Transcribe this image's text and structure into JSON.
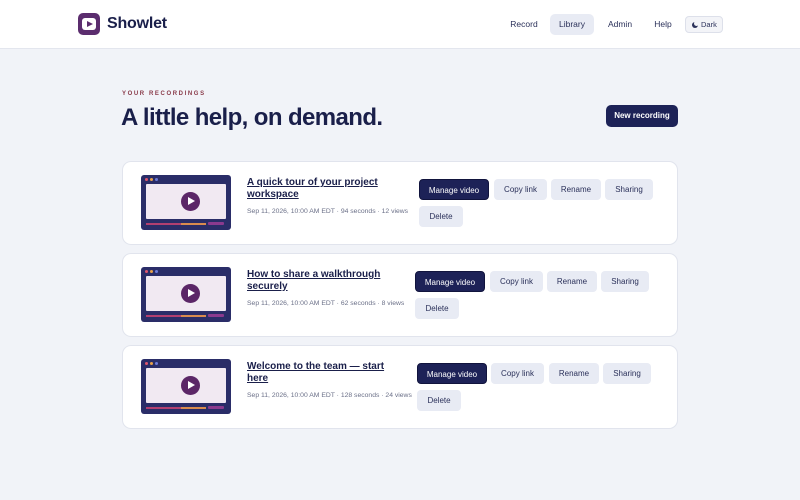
{
  "app": {
    "name": "Showlet"
  },
  "nav": {
    "items": [
      {
        "label": "Record",
        "active": false
      },
      {
        "label": "Library",
        "active": true
      },
      {
        "label": "Admin",
        "active": false
      },
      {
        "label": "Help",
        "active": false
      }
    ],
    "theme_toggle": {
      "label": "Dark",
      "icon": "moon-icon"
    }
  },
  "header": {
    "eyebrow": "YOUR RECORDINGS",
    "title": "A little help, on demand.",
    "new_button": "New recording"
  },
  "recordings": [
    {
      "title": "A quick tour of your project workspace",
      "meta": "Sep 11, 2026, 10:00 AM EDT · 94 seconds · 12 views",
      "actions": {
        "manage": "Manage video",
        "copy": "Copy link",
        "rename": "Rename",
        "sharing": "Sharing",
        "delete": "Delete"
      }
    },
    {
      "title": "How to share a walkthrough securely",
      "meta": "Sep 11, 2026, 10:00 AM EDT · 62 seconds · 8 views",
      "actions": {
        "manage": "Manage video",
        "copy": "Copy link",
        "rename": "Rename",
        "sharing": "Sharing",
        "delete": "Delete"
      }
    },
    {
      "title": "Welcome to the team — start here",
      "meta": "Sep 11, 2026, 10:00 AM EDT · 128 seconds · 24 views",
      "actions": {
        "manage": "Manage video",
        "copy": "Copy link",
        "rename": "Rename",
        "sharing": "Sharing",
        "delete": "Delete"
      }
    }
  ],
  "colors": {
    "primary": "#1d2257",
    "brand": "#5b2d6e",
    "accent_eyebrow": "#8a3b4a",
    "background": "#f1f3f8"
  }
}
